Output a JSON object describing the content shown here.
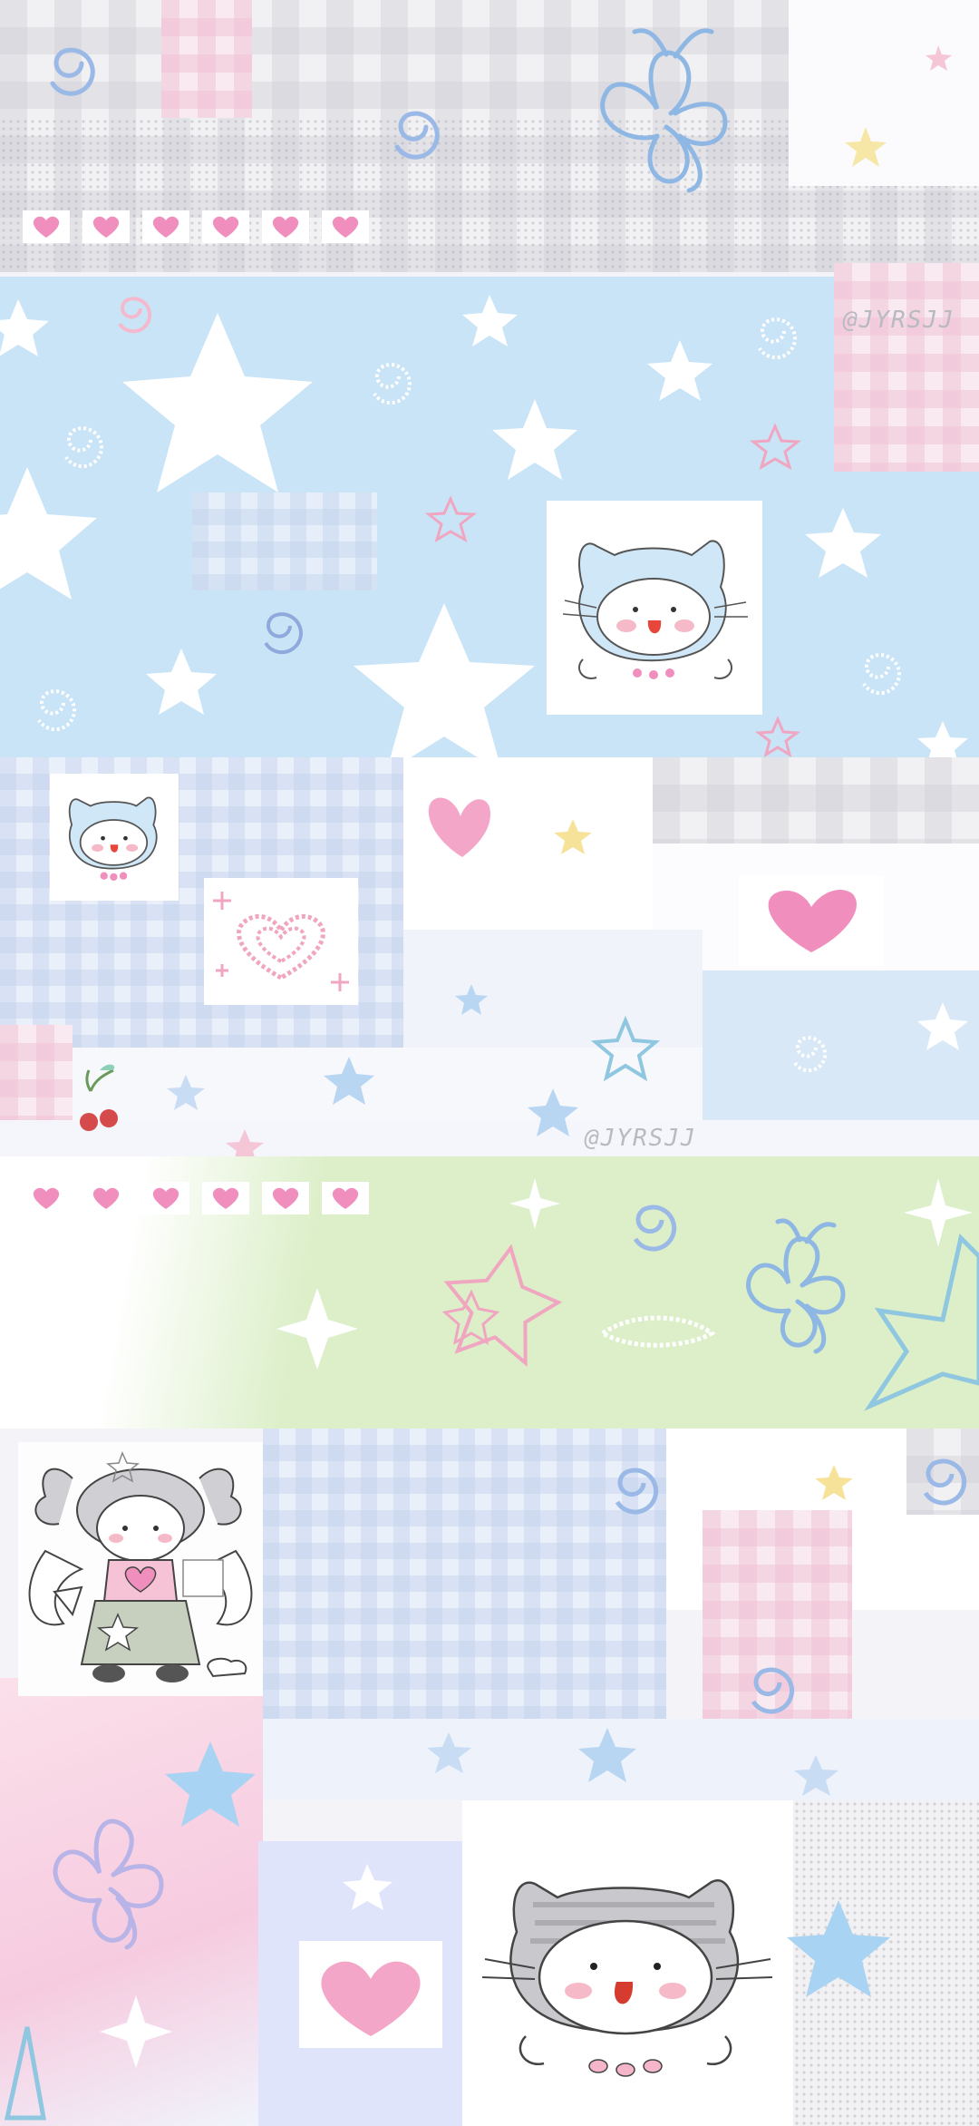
{
  "watermark_top": "@JYRSJJ",
  "watermark_middle": "@JYRSJJ",
  "colors": {
    "sky_blue": "#c9e4f7",
    "mint_green": "#dcefc9",
    "pink_heart": "#f08fbd",
    "star_white": "#ffffff",
    "outline_blue": "#8fb7e4",
    "outline_pink": "#f0a6c0"
  },
  "icons": [
    "heart-icon",
    "star-icon",
    "swirl-icon",
    "butterfly-icon",
    "cat-drawing",
    "cherry-icon",
    "angel-girl-drawing",
    "sparkle-icon"
  ]
}
